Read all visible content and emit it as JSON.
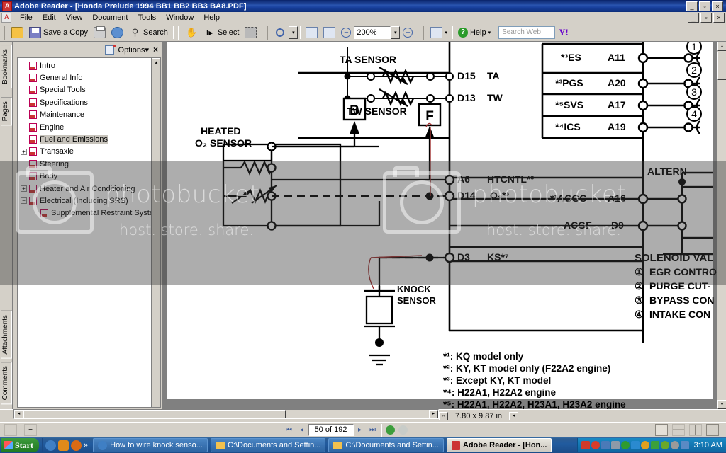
{
  "window": {
    "title": "Adobe Reader - [Honda Prelude 1994 BB1 BB2 BB3 BA8.PDF]",
    "app_icon": "adobe-reader-icon",
    "min_label": "_",
    "restore_label": "▫",
    "close_label": "×"
  },
  "menu": {
    "items": [
      {
        "label": "File"
      },
      {
        "label": "Edit"
      },
      {
        "label": "View"
      },
      {
        "label": "Document"
      },
      {
        "label": "Tools"
      },
      {
        "label": "Window"
      },
      {
        "label": "Help"
      }
    ],
    "doc_min": "_",
    "doc_restore": "▫",
    "doc_close": "×"
  },
  "toolbar": {
    "open_label": "",
    "save_label": "Save a Copy",
    "print_label": "",
    "email_label": "",
    "search_label": "Search",
    "hand_label": "",
    "select_label": "Select",
    "snapshot_label": "",
    "zoom_in_label": "",
    "zoom_dropdown_label": "▾",
    "fit_page_label": "",
    "fit_width_label": "",
    "zoom_out_btn": "−",
    "zoom_value": "200%",
    "zoom_combo_arrow": "▾",
    "zoom_plus_btn": "+",
    "review_label": "",
    "help_label": "Help",
    "help_arrow": "▾",
    "search_web_placeholder": "Search Web",
    "yahoo_label": "Y!"
  },
  "sidetabs": [
    {
      "label": "Bookmarks"
    },
    {
      "label": "Pages"
    },
    {
      "label": "Attachments"
    },
    {
      "label": "Comments"
    }
  ],
  "bookmarks_panel": {
    "options_label": "Options",
    "options_arrow": "▾",
    "close_label": "×",
    "new_bookmark_icon": "new-bookmark-icon",
    "scroll_up": "▴",
    "scroll_down": "▾",
    "items": [
      {
        "label": "Intro",
        "level": 1,
        "expander": "",
        "selected": false
      },
      {
        "label": "General Info",
        "level": 1,
        "expander": "",
        "selected": false
      },
      {
        "label": "Special Tools",
        "level": 1,
        "expander": "",
        "selected": false
      },
      {
        "label": "Specifications",
        "level": 1,
        "expander": "",
        "selected": false
      },
      {
        "label": "Maintenance",
        "level": 1,
        "expander": "",
        "selected": false
      },
      {
        "label": "Engine",
        "level": 1,
        "expander": "",
        "selected": false
      },
      {
        "label": "Fuel and Emissions",
        "level": 1,
        "expander": "",
        "selected": true
      },
      {
        "label": "Transaxle",
        "level": 1,
        "expander": "+",
        "selected": false
      },
      {
        "label": "Steering",
        "level": 1,
        "expander": "",
        "selected": false
      },
      {
        "label": "Body",
        "level": 1,
        "expander": "",
        "selected": false
      },
      {
        "label": "Heater and Air Conditioning",
        "level": 1,
        "expander": "+",
        "selected": false
      },
      {
        "label": "Electrical (Including SRS)",
        "level": 1,
        "expander": "−",
        "selected": false
      },
      {
        "label": "Supplemental Restraint System",
        "level": 2,
        "expander": "",
        "selected": false
      }
    ]
  },
  "watermark": {
    "brand": "photobucket",
    "tagline": "host. store. share."
  },
  "diagram": {
    "labels": {
      "ta_sensor": "TA SENSOR",
      "tw_sensor": "TW SENSOR",
      "heated_o2_line1": "HEATED",
      "heated_o2_line2": "O₂ SENSOR",
      "knock_line1": "KNOCK",
      "knock_line2": "SENSOR",
      "alternator": "ALTERN",
      "connector_b": "B",
      "connector_f": "F"
    },
    "pins_left": [
      {
        "pin": "D15",
        "signal": "TA"
      },
      {
        "pin": "D13",
        "signal": "TW"
      },
      {
        "pin": "A6",
        "signal": "HTCNTL*³"
      },
      {
        "pin": "D14",
        "signal": "O₂*³"
      },
      {
        "pin": "D3",
        "signal": "KS*⁷"
      }
    ],
    "pins_right": [
      {
        "signal": "*³ES",
        "pin": "A11",
        "circle": "①"
      },
      {
        "signal": "*³PGS",
        "pin": "A20",
        "circle": "②"
      },
      {
        "signal": "*⁵SVS",
        "pin": "A17",
        "circle": "③"
      },
      {
        "signal": "*⁴ICS",
        "pin": "A19",
        "circle": "④"
      },
      {
        "signal": "*¹ACGC",
        "pin": "A16",
        "circle": ""
      },
      {
        "signal": "ACGF",
        "pin": "D9",
        "circle": ""
      }
    ],
    "solenoid": {
      "title": "SOLENOID VAL",
      "items": [
        {
          "num": "①",
          "label": "EGR CONTRO"
        },
        {
          "num": "②",
          "label": "PURGE CUT-"
        },
        {
          "num": "③",
          "label": "BYPASS CON"
        },
        {
          "num": "④",
          "label": "INTAKE CON"
        }
      ]
    },
    "footnotes": [
      "*¹: KQ model only",
      "*²: KY, KT model only (F22A2 engine)",
      "*³: Except KY, KT model",
      "*⁴: H22A1, H22A2 engine",
      "*⁵: H22A1, H22A2, H23A1, H23A2 engine"
    ]
  },
  "statusbar": {
    "page_size": "7.80 x 9.87 in",
    "resize_icon": "↔",
    "collapse_icon": "◂"
  },
  "navbar": {
    "first_page": "⏮",
    "prev_page": "◂",
    "page_indicator": "50 of 192",
    "next_page": "▸",
    "last_page": "⏭",
    "prev_view": "◀",
    "next_view": "▶",
    "layout_single": "single-page-icon",
    "layout_continuous": "continuous-icon",
    "layout_facing": "facing-icon",
    "layout_cont_facing": "continuous-facing-icon",
    "fullscreen_icon": "fullscreen-icon",
    "minimize_icon": "−"
  },
  "taskbar": {
    "start_label": "Start",
    "quicklaunch": [
      {
        "name": "internet-explorer-icon",
        "color": "#3f7fc4"
      },
      {
        "name": "media-player-icon",
        "color": "#e08a1a"
      },
      {
        "name": "firefox-icon",
        "color": "#d96a14"
      },
      {
        "name": "more-icon",
        "color": "#cfd8e6"
      }
    ],
    "more_label": "»",
    "buttons": [
      {
        "label": "How to wire knock senso...",
        "icon": "browser-icon",
        "active": false
      },
      {
        "label": "C:\\Documents and Settin...",
        "icon": "folder-icon",
        "active": false
      },
      {
        "label": "C:\\Documents and Settin...",
        "icon": "folder-icon",
        "active": false
      },
      {
        "label": "Adobe Reader - [Hon...",
        "icon": "adobe-icon",
        "active": true
      }
    ],
    "tray_icons": [
      {
        "name": "network-disconnected-icon",
        "color": "#d03a2a"
      },
      {
        "name": "security-shield-icon",
        "color": "#d93c2a"
      },
      {
        "name": "printer-icon",
        "color": "#4a7ab8"
      },
      {
        "name": "monitor-icon",
        "color": "#8e9aa8"
      },
      {
        "name": "antivirus-icon",
        "color": "#2f9b2f"
      },
      {
        "name": "update-icon",
        "color": "#2a8ad0"
      },
      {
        "name": "volume-icon",
        "color": "#e0a020"
      },
      {
        "name": "sync-icon",
        "color": "#3ba03b"
      },
      {
        "name": "messenger-icon",
        "color": "#6aa82a"
      },
      {
        "name": "clock-icon",
        "color": "#9a9a9a"
      },
      {
        "name": "display-icon",
        "color": "#5a8ac4"
      }
    ],
    "clock": "3:10 AM"
  },
  "colors": {
    "titlebar_blue": "#0a246a",
    "face": "#d4d0c8",
    "pdf_bg": "#808080",
    "selection": "#c8c4bc",
    "taskbar_blue": "#215b9e"
  }
}
